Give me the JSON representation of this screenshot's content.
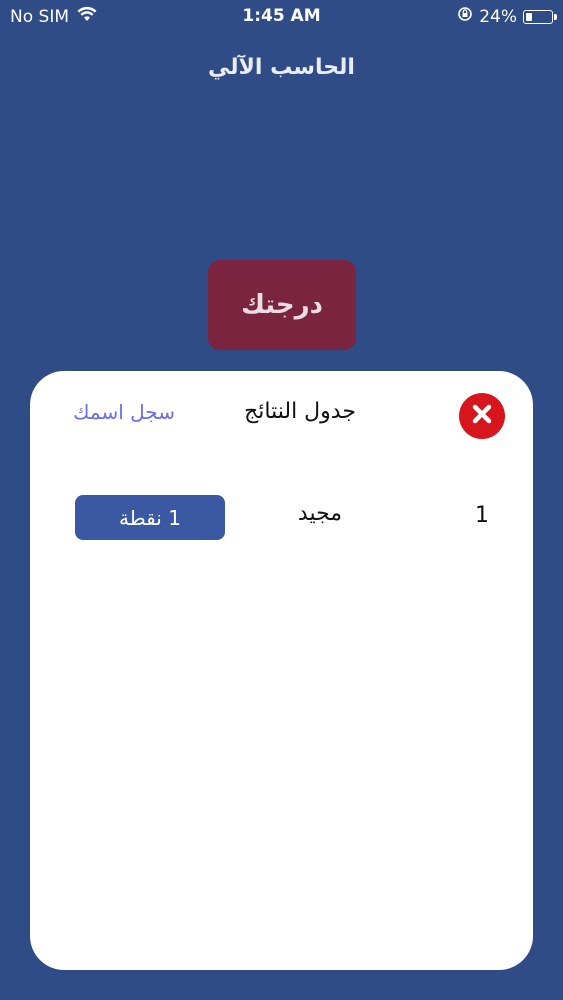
{
  "status_bar": {
    "carrier": "No SIM",
    "time": "1:45 AM",
    "battery_percent": "24%",
    "battery_level": 0.24,
    "icons": [
      "wifi-icon",
      "orientation-lock-icon",
      "battery-icon"
    ]
  },
  "app": {
    "title": "الحاسب الآلي"
  },
  "score_button": {
    "label": "درجتك"
  },
  "leaderboard": {
    "title": "جدول النتائج",
    "register_label": "سجل اسمك",
    "close_icon": "close-icon",
    "rows": [
      {
        "rank": "1",
        "name": "مجيد",
        "points": "1 نقطة"
      }
    ]
  },
  "colors": {
    "background": "#2f4c86",
    "score_button": "#7a2440",
    "modal": "#ffffff",
    "close_button": "#d6161c",
    "register_link": "#6b6fe8",
    "points_badge": "#3b59a3"
  }
}
